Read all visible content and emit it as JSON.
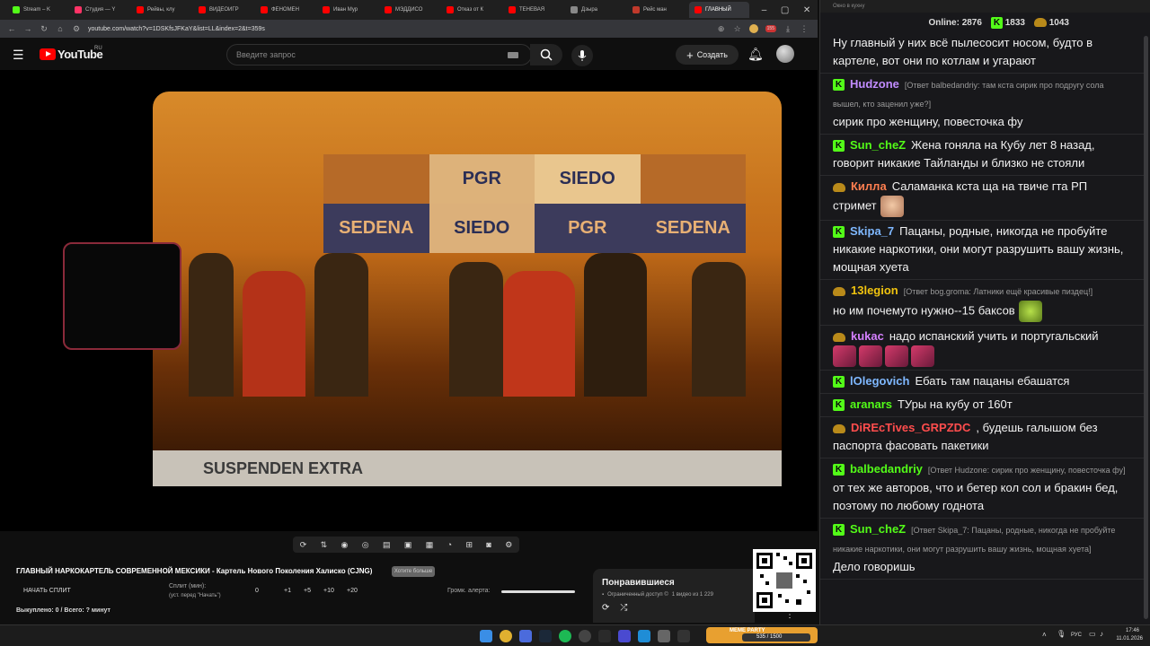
{
  "browser": {
    "tabs": [
      {
        "label": "Stream – K",
        "color": "#53fc18"
      },
      {
        "label": "Студия — Y",
        "color": "#ff3366"
      },
      {
        "label": "Рейвы, клу",
        "color": "#ff0000"
      },
      {
        "label": "ВИДЕОИГР",
        "color": "#ff0000"
      },
      {
        "label": "ФЕНОМЕН",
        "color": "#ff0000"
      },
      {
        "label": "Иван Мур",
        "color": "#ff0000"
      },
      {
        "label": "МЭДДИСО",
        "color": "#ff0000"
      },
      {
        "label": "Отказ от К",
        "color": "#ff0000"
      },
      {
        "label": "ТЕНЕВАЯ",
        "color": "#ff0000"
      },
      {
        "label": "Дзыра",
        "color": "#888888"
      },
      {
        "label": "Рейс ман",
        "color": "#c0392b"
      },
      {
        "label": "ГЛАВНЫЙ",
        "color": "#ff0000"
      }
    ],
    "url": "youtube.com/watch?v=1DSKfsJFKaY&list=LL&index=2&t=359s",
    "ext_badge": "155"
  },
  "youtube": {
    "logo_text": "YouTube",
    "region": "RU",
    "search_placeholder": "Введите запрос",
    "create_label": "Создать"
  },
  "video": {
    "banner_words": [
      "PGR",
      "SIEDO",
      "SEDENA",
      "SIEDO",
      "PGR",
      "SEDENA"
    ],
    "caption": "SUSPENDEN EXTRA"
  },
  "below": {
    "title": "ГЛАВНЫЙ НАРКОКАРТЕЛЬ СОВРЕМЕННОЙ МЕКСИКИ - Картель Нового Поколения Халиско (CJNG)",
    "badge": "Хотите больше",
    "split_button": "НАЧАТЬ СПЛИТ",
    "split_label": "Сплит (мин):",
    "split_hint": "(уст. перед \"Начать\")",
    "split_value": "0",
    "increments": [
      "+1",
      "+5",
      "+10",
      "+20"
    ],
    "alert_label": "Громк. алерта:",
    "bought": "Выкуплено: 0 / Всего: ? минут"
  },
  "liked": {
    "title": "Понравившиеся",
    "meta": "Ограниченный доступ ©",
    "count": "1 видео из 1 229"
  },
  "chat": {
    "window_title": "Окно в кухну",
    "online_label": "Online:",
    "online": "2876",
    "kick_count": "1833",
    "extra_count": "1043",
    "messages": [
      {
        "user": "",
        "color": "#ffffff",
        "reply": "",
        "text": "Ну главный у них всё пылесосит носом, будто в картеле, вот они по котлам и угарают",
        "icon": "none"
      },
      {
        "user": "Hudzone",
        "color": "#c18cff",
        "reply": "[Ответ balbedandriy: там кста сирик про подругу сола вышел, кто заценил уже?]",
        "text": "сирик про женщину, повесточка фу",
        "icon": "kick"
      },
      {
        "user": "Sun_cheZ",
        "color": "#53fc18",
        "reply": "",
        "text": "Жена гоняла на Кубу лет 8 назад, говорит никакие Тайланды и близко не стояли",
        "icon": "kick"
      },
      {
        "user": "Килла",
        "color": "#ff7f50",
        "reply": "",
        "text": "Саламанка кста ща на твиче гта РП стримет",
        "icon": "emote"
      },
      {
        "user": "Skipa_7",
        "color": "#7fb8ff",
        "reply": "",
        "text": "Пацаны, родные, никогда не пробуйте никакие наркотики, они могут разрушить вашу жизнь, мощная хуета",
        "icon": "kick"
      },
      {
        "user": "13legion",
        "color": "#f1c40f",
        "reply": "[Ответ bog.groma: Латники ещё красивые пиздец!]",
        "text": "но им почемуто нужно--15 баксов",
        "icon": "emote"
      },
      {
        "user": "kukac",
        "color": "#d580ff",
        "reply": "",
        "text": "надо испанский учить и португальский",
        "icon": "emote"
      },
      {
        "user": "lOlegovich",
        "color": "#7fb8ff",
        "reply": "",
        "text": "Ебать там пацаны ебашатся",
        "icon": "kick"
      },
      {
        "user": "aranars",
        "color": "#53fc18",
        "reply": "",
        "text": "ТУры на кубу от 160т",
        "icon": "kick"
      },
      {
        "user": "DiREcTives_GRPZDC",
        "color": "#ff4d4d",
        "reply": "",
        "text": ", будешь галышом без паспорта фасовать пакетики",
        "icon": "emote"
      },
      {
        "user": "balbedandriy",
        "color": "#53fc18",
        "reply": "[Ответ Hudzone: сирик про женщину, повесточка фу]",
        "text": "от тех же авторов, что и бетер кол сол и бракин бед, поэтому по любому годнота",
        "icon": "kick"
      },
      {
        "user": "Sun_cheZ",
        "color": "#53fc18",
        "reply": "[Ответ Skipa_7: Пацаны, родные, никогда не пробуйте никакие наркотики, они могут разрушить вашу жизнь, мощная хуета]",
        "text": "Дело говоришь",
        "icon": "kick"
      }
    ]
  },
  "taskbar": {
    "widget": "MEME PARTY",
    "widget_progress": "535 / 1500",
    "lang": "РУС",
    "time": "17:46",
    "date": "11.01.2026"
  }
}
